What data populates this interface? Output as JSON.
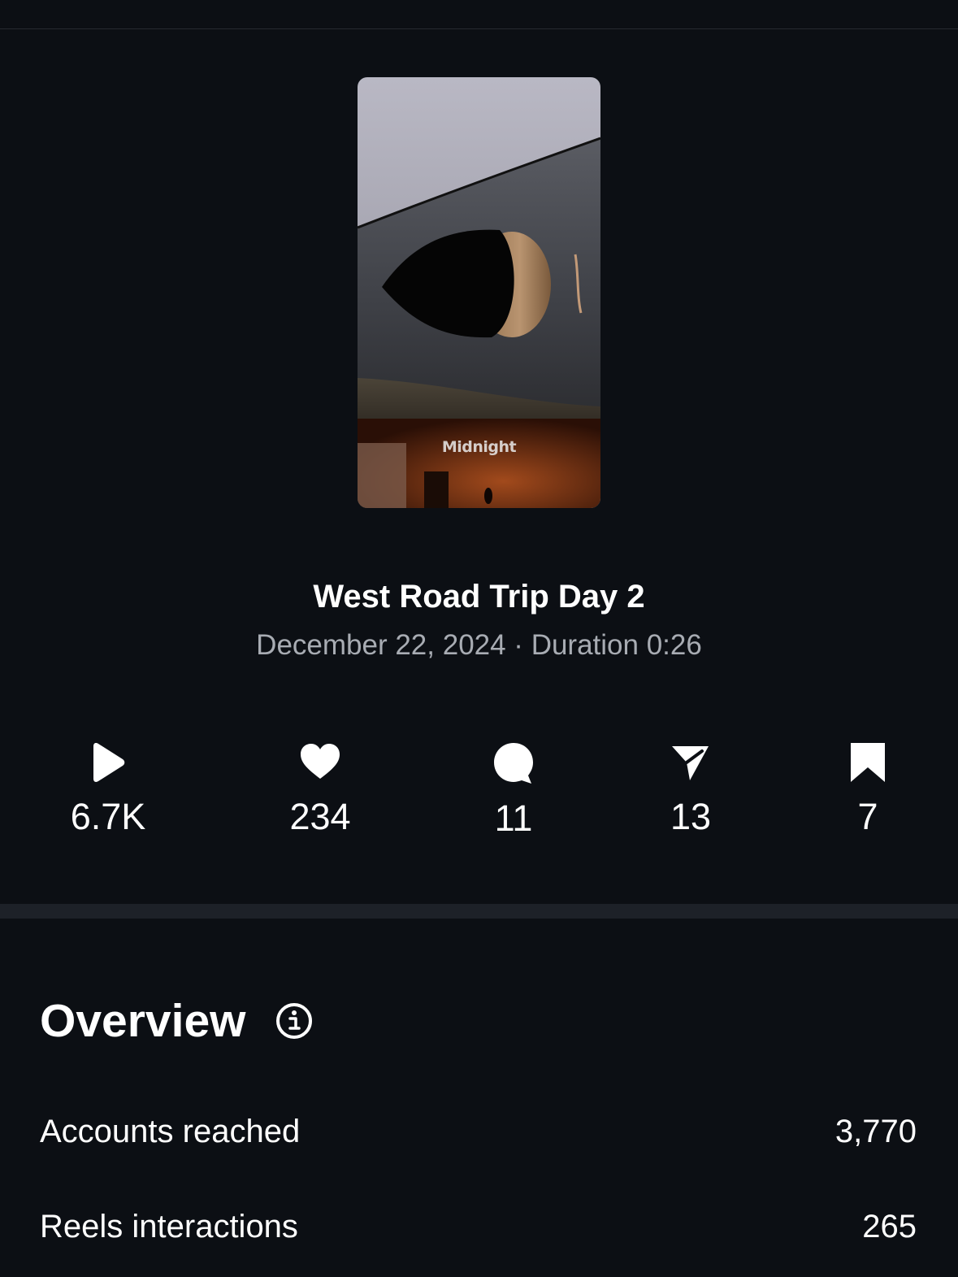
{
  "reel": {
    "title": "West Road Trip Day 2",
    "date": "December 22, 2024",
    "separator": "·",
    "duration_label": "Duration",
    "duration": "0:26",
    "subtitle": "December 22, 2024 · Duration 0:26",
    "thumbnail_watermark": "Midnight"
  },
  "stats": [
    {
      "icon": "play-icon",
      "value": "6.7K"
    },
    {
      "icon": "heart-icon",
      "value": "234"
    },
    {
      "icon": "comment-icon",
      "value": "11"
    },
    {
      "icon": "share-icon",
      "value": "13"
    },
    {
      "icon": "bookmark-icon",
      "value": "7"
    }
  ],
  "overview": {
    "title": "Overview",
    "info_icon": "info-icon",
    "rows": [
      {
        "label": "Accounts reached",
        "value": "3,770"
      },
      {
        "label": "Reels interactions",
        "value": "265"
      }
    ]
  },
  "colors": {
    "background": "#0c0f14",
    "text": "#ffffff",
    "secondary_text": "#a8acb3",
    "divider": "#1d2128"
  }
}
